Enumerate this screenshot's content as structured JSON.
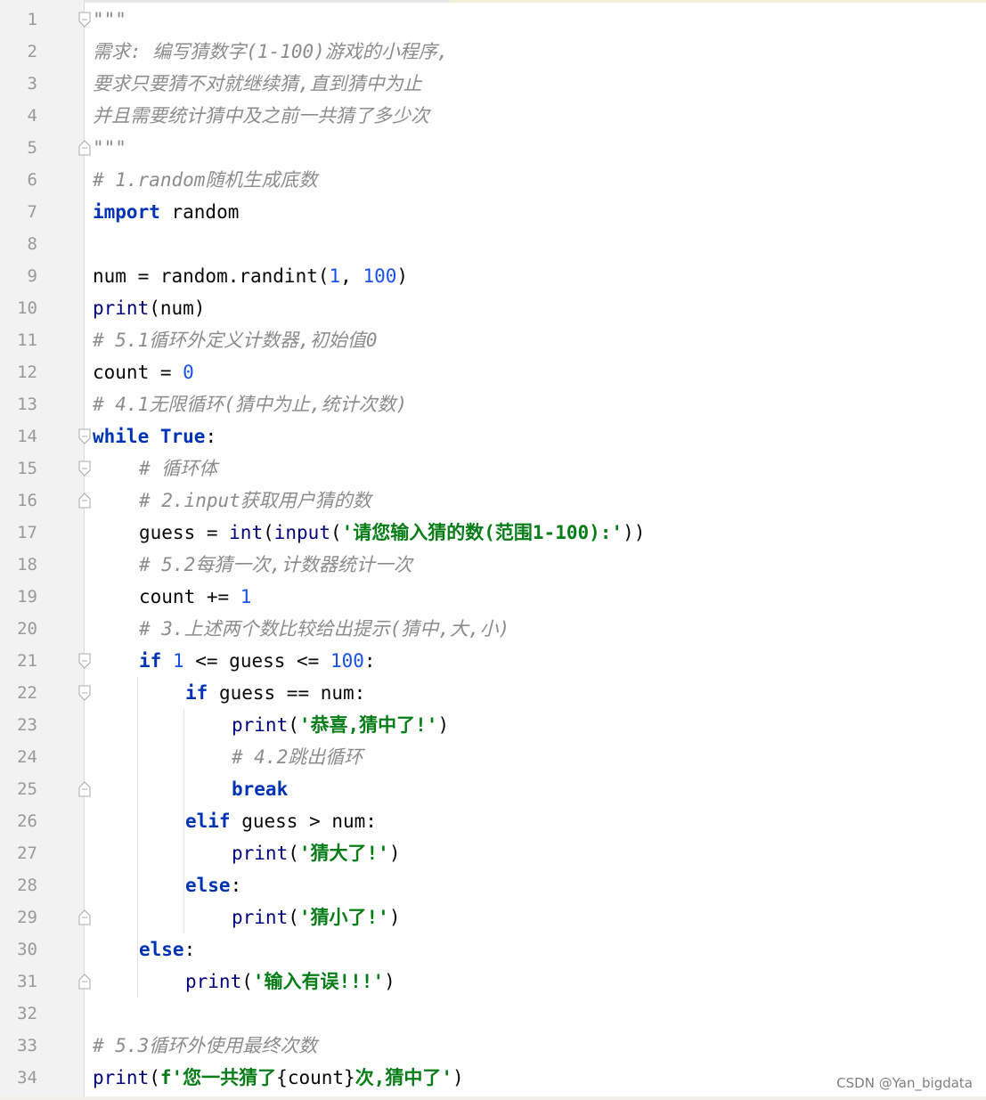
{
  "editor": {
    "language": "python",
    "watermark": "CSDN @Yan_bigdata",
    "lines": [
      {
        "n": "1",
        "indent": 0,
        "tokens": [
          {
            "t": "\"\"\"",
            "c": "cm"
          }
        ]
      },
      {
        "n": "2",
        "indent": 0,
        "tokens": [
          {
            "t": "需求: 编写猜数字(1-100)游戏的小程序,",
            "c": "cm"
          }
        ]
      },
      {
        "n": "3",
        "indent": 0,
        "tokens": [
          {
            "t": "要求只要猜不对就继续猜,直到猜中为止",
            "c": "cm"
          }
        ]
      },
      {
        "n": "4",
        "indent": 0,
        "tokens": [
          {
            "t": "并且需要统计猜中及之前一共猜了多少次",
            "c": "cm"
          }
        ]
      },
      {
        "n": "5",
        "indent": 0,
        "tokens": [
          {
            "t": "\"\"\"",
            "c": "cm"
          }
        ]
      },
      {
        "n": "6",
        "indent": 0,
        "tokens": [
          {
            "t": "# 1.random随机生成底数",
            "c": "cm"
          }
        ]
      },
      {
        "n": "7",
        "indent": 0,
        "tokens": [
          {
            "t": "import",
            "c": "kw"
          },
          {
            "t": " random",
            "c": "op"
          }
        ]
      },
      {
        "n": "8",
        "indent": 0,
        "tokens": []
      },
      {
        "n": "9",
        "indent": 0,
        "tokens": [
          {
            "t": "num = random.randint(",
            "c": "op"
          },
          {
            "t": "1",
            "c": "num"
          },
          {
            "t": ", ",
            "c": "op"
          },
          {
            "t": "100",
            "c": "num"
          },
          {
            "t": ")",
            "c": "op"
          }
        ]
      },
      {
        "n": "10",
        "indent": 0,
        "tokens": [
          {
            "t": "print",
            "c": "bi"
          },
          {
            "t": "(num)",
            "c": "op"
          }
        ]
      },
      {
        "n": "11",
        "indent": 0,
        "tokens": [
          {
            "t": "# 5.1循环外定义计数器,初始值0",
            "c": "cm"
          }
        ]
      },
      {
        "n": "12",
        "indent": 0,
        "tokens": [
          {
            "t": "count = ",
            "c": "op"
          },
          {
            "t": "0",
            "c": "num"
          }
        ]
      },
      {
        "n": "13",
        "indent": 0,
        "tokens": [
          {
            "t": "# 4.1无限循环(猜中为止,统计次数)",
            "c": "cm"
          }
        ]
      },
      {
        "n": "14",
        "indent": 0,
        "tokens": [
          {
            "t": "while",
            "c": "kw"
          },
          {
            "t": " ",
            "c": "op"
          },
          {
            "t": "True",
            "c": "kw"
          },
          {
            "t": ":",
            "c": "op"
          }
        ]
      },
      {
        "n": "15",
        "indent": 1,
        "tokens": [
          {
            "t": "# 循环体",
            "c": "cm"
          }
        ]
      },
      {
        "n": "16",
        "indent": 1,
        "tokens": [
          {
            "t": "# 2.input获取用户猜的数",
            "c": "cm"
          }
        ]
      },
      {
        "n": "17",
        "indent": 1,
        "tokens": [
          {
            "t": "guess = ",
            "c": "op"
          },
          {
            "t": "int",
            "c": "bi"
          },
          {
            "t": "(",
            "c": "op"
          },
          {
            "t": "input",
            "c": "bi"
          },
          {
            "t": "(",
            "c": "op"
          },
          {
            "t": "'请您输入猜的数(范围1-100):'",
            "c": "str"
          },
          {
            "t": "))",
            "c": "op"
          }
        ]
      },
      {
        "n": "18",
        "indent": 1,
        "tokens": [
          {
            "t": "# 5.2每猜一次,计数器统计一次",
            "c": "cm"
          }
        ]
      },
      {
        "n": "19",
        "indent": 1,
        "tokens": [
          {
            "t": "count += ",
            "c": "op"
          },
          {
            "t": "1",
            "c": "num"
          }
        ]
      },
      {
        "n": "20",
        "indent": 1,
        "tokens": [
          {
            "t": "# 3.上述两个数比较给出提示(猜中,大,小)",
            "c": "cm"
          }
        ]
      },
      {
        "n": "21",
        "indent": 1,
        "tokens": [
          {
            "t": "if",
            "c": "kw"
          },
          {
            "t": " ",
            "c": "op"
          },
          {
            "t": "1",
            "c": "num"
          },
          {
            "t": " <= guess <= ",
            "c": "op"
          },
          {
            "t": "100",
            "c": "num"
          },
          {
            "t": ":",
            "c": "op"
          }
        ]
      },
      {
        "n": "22",
        "indent": 2,
        "tokens": [
          {
            "t": "if",
            "c": "kw"
          },
          {
            "t": " guess == num:",
            "c": "op"
          }
        ]
      },
      {
        "n": "23",
        "indent": 3,
        "tokens": [
          {
            "t": "print",
            "c": "bi"
          },
          {
            "t": "(",
            "c": "op"
          },
          {
            "t": "'恭喜,猜中了!'",
            "c": "str"
          },
          {
            "t": ")",
            "c": "op"
          }
        ]
      },
      {
        "n": "24",
        "indent": 3,
        "tokens": [
          {
            "t": "# 4.2跳出循环",
            "c": "cm"
          }
        ]
      },
      {
        "n": "25",
        "indent": 3,
        "tokens": [
          {
            "t": "break",
            "c": "kw"
          }
        ]
      },
      {
        "n": "26",
        "indent": 2,
        "tokens": [
          {
            "t": "elif",
            "c": "kw"
          },
          {
            "t": " guess > num:",
            "c": "op"
          }
        ]
      },
      {
        "n": "27",
        "indent": 3,
        "tokens": [
          {
            "t": "print",
            "c": "bi"
          },
          {
            "t": "(",
            "c": "op"
          },
          {
            "t": "'猜大了!'",
            "c": "str"
          },
          {
            "t": ")",
            "c": "op"
          }
        ]
      },
      {
        "n": "28",
        "indent": 2,
        "tokens": [
          {
            "t": "else",
            "c": "kw"
          },
          {
            "t": ":",
            "c": "op"
          }
        ]
      },
      {
        "n": "29",
        "indent": 3,
        "tokens": [
          {
            "t": "print",
            "c": "bi"
          },
          {
            "t": "(",
            "c": "op"
          },
          {
            "t": "'猜小了!'",
            "c": "str"
          },
          {
            "t": ")",
            "c": "op"
          }
        ]
      },
      {
        "n": "30",
        "indent": 1,
        "tokens": [
          {
            "t": "else",
            "c": "kw"
          },
          {
            "t": ":",
            "c": "op"
          }
        ]
      },
      {
        "n": "31",
        "indent": 2,
        "tokens": [
          {
            "t": "print",
            "c": "bi"
          },
          {
            "t": "(",
            "c": "op"
          },
          {
            "t": "'输入有误!!!'",
            "c": "str"
          },
          {
            "t": ")",
            "c": "op"
          }
        ]
      },
      {
        "n": "32",
        "indent": 0,
        "tokens": []
      },
      {
        "n": "33",
        "indent": 0,
        "tokens": [
          {
            "t": "# 5.3循环外使用最终次数",
            "c": "cm"
          }
        ]
      },
      {
        "n": "34",
        "indent": 0,
        "tokens": [
          {
            "t": "print",
            "c": "bi"
          },
          {
            "t": "(",
            "c": "op"
          },
          {
            "t": "f'您一共猜了",
            "c": "str"
          },
          {
            "t": "{count}",
            "c": "op"
          },
          {
            "t": "次,猜中了'",
            "c": "str"
          },
          {
            "t": ")",
            "c": "op"
          }
        ]
      }
    ],
    "fold_open_lines": [
      "1",
      "14",
      "15",
      "21",
      "22"
    ],
    "fold_close_lines": [
      "5",
      "16",
      "25",
      "29",
      "31"
    ],
    "colors": {
      "keyword": "#0033b3",
      "builtin": "#000080",
      "number": "#1750eb",
      "string": "#067d17",
      "comment": "#8c8c8c",
      "gutter_bg": "#f2f2f2",
      "line_number": "#999999"
    }
  }
}
